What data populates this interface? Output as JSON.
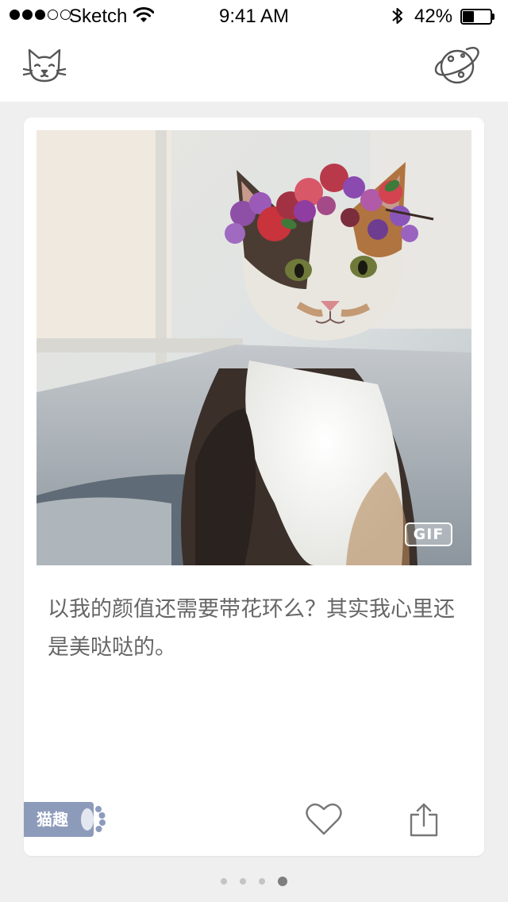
{
  "status_bar": {
    "carrier": "Sketch",
    "time": "9:41 AM",
    "battery_percent": "42%",
    "battery_level": 0.42,
    "signal_bars_filled": 3,
    "signal_bars_total": 5,
    "icons": [
      "wifi-icon",
      "bluetooth-icon",
      "battery-icon"
    ]
  },
  "nav": {
    "left_icon": "cat-face-icon",
    "right_icon": "planet-icon"
  },
  "card": {
    "image_badge": "GIF",
    "caption": "以我的颜值还需要带花环么？其实我心里还是美哒哒的。",
    "tag_label": "猫趣",
    "tag_color": "#8d9bbb",
    "actions": [
      "heart-icon",
      "share-icon"
    ]
  },
  "pager": {
    "total": 4,
    "current": 4
  },
  "colors": {
    "background": "#efefef",
    "card": "#ffffff",
    "caption_text": "#666666",
    "icon_stroke": "#555555"
  }
}
